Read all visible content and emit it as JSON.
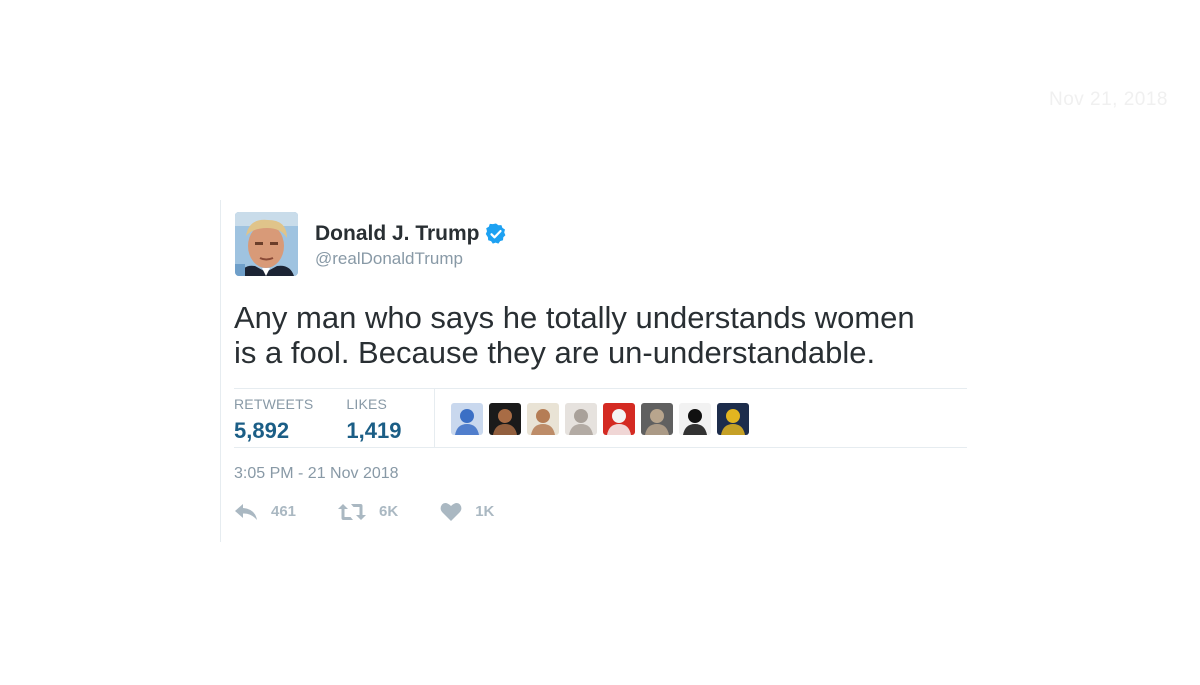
{
  "watermark": {
    "date": "Nov 21, 2018"
  },
  "tweet": {
    "author": {
      "display_name": "Donald J. Trump",
      "handle": "@realDonaldTrump",
      "verified": true,
      "avatar_icon": "profile-photo"
    },
    "text_lines": [
      "Any man who says he totally understands women",
      "is a fool. Because they are un-understandable."
    ],
    "stats": {
      "retweets_label": "RETWEETS",
      "retweets_value": "5,892",
      "likes_label": "LIKES",
      "likes_value": "1,419"
    },
    "liker_avatars": [
      {
        "name": "liker-avatar-1",
        "colors": [
          "#c9d8ee",
          "#3b6fc5"
        ]
      },
      {
        "name": "liker-avatar-2",
        "colors": [
          "#1a1a1a",
          "#a86c45"
        ]
      },
      {
        "name": "liker-avatar-3",
        "colors": [
          "#e9e3d5",
          "#b57d55"
        ]
      },
      {
        "name": "liker-avatar-4",
        "colors": [
          "#e6e2de",
          "#a9a19a"
        ]
      },
      {
        "name": "liker-avatar-5",
        "colors": [
          "#d42a22",
          "#f4f4f4"
        ]
      },
      {
        "name": "liker-avatar-6",
        "colors": [
          "#606060",
          "#b8a58d"
        ]
      },
      {
        "name": "liker-avatar-7",
        "colors": [
          "#f2f2f2",
          "#111111"
        ]
      },
      {
        "name": "liker-avatar-8",
        "colors": [
          "#1d2d4c",
          "#e3b520"
        ]
      }
    ],
    "timestamp": "3:05 PM - 21 Nov 2018",
    "actions": {
      "reply_count": "461",
      "retweet_count": "6K",
      "like_count": "1K"
    }
  },
  "colors": {
    "verified_blue": "#1da1f2",
    "text_primary": "#292f33",
    "text_secondary": "#8899a6",
    "action_gray": "#aab8c2"
  }
}
